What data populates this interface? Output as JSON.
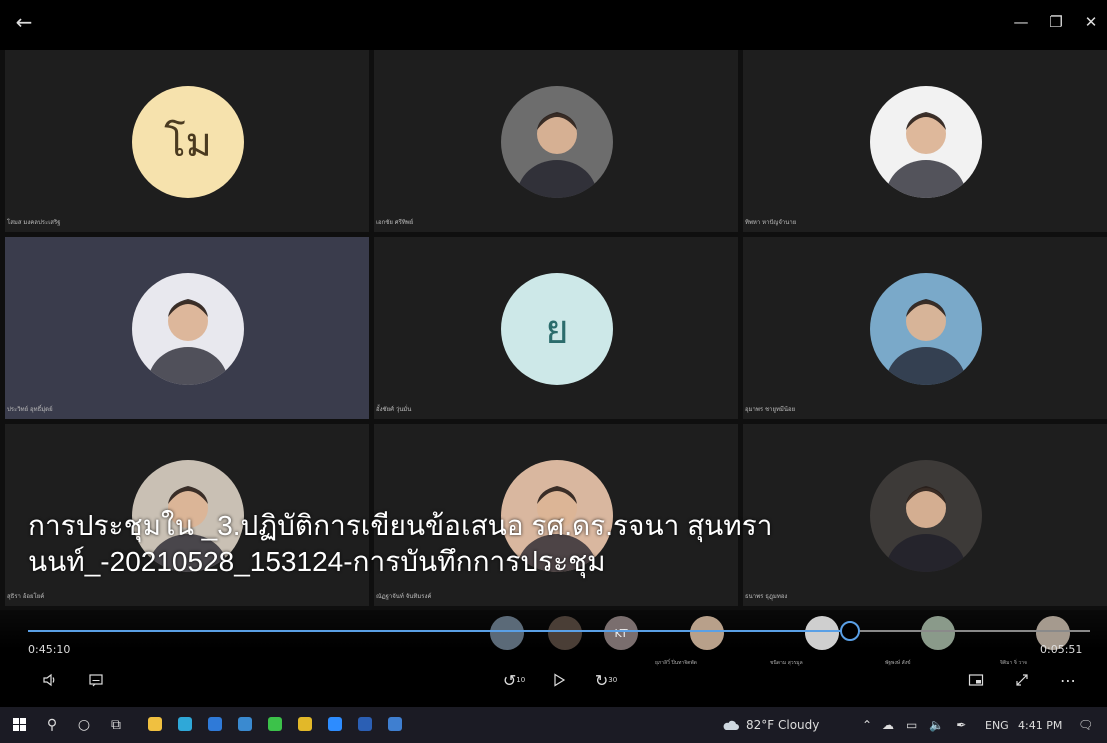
{
  "window": {
    "back_icon": "arrow-left-icon",
    "min_icon": "minimize-icon",
    "max_icon": "restore-icon",
    "close_icon": "close-icon"
  },
  "tiles": [
    {
      "name": "โสมส มงคลประเสริฐ",
      "initials": "โม",
      "avatar_color": "#f6e2ad",
      "active": false
    },
    {
      "name": "เอกชัย ศรีทิพย์",
      "initials": "",
      "avatar_color": "#6d6d6d",
      "active": false
    },
    {
      "name": "ทิพหา หาปัญจำนาย",
      "initials": "",
      "avatar_color": "#f2f2f2",
      "active": false
    },
    {
      "name": "ประวิทย์ อุทธิ์มุ่ดย์",
      "initials": "",
      "avatar_color": "#e8e8ee",
      "active": true
    },
    {
      "name": "อั้งชัยศ์ วุ่นมั่น",
      "initials": "ย",
      "avatar_color": "#cde8e8",
      "active": false
    },
    {
      "name": "อุมาพร ชายูทมีน้อย",
      "initials": "",
      "avatar_color": "#7aa9c9",
      "active": false
    },
    {
      "name": "สุธิรา อ้อยโยค์",
      "initials": "",
      "avatar_color": "#c9c0b4",
      "active": false
    },
    {
      "name": "ณัฏฐาจันท์ จันทิมรงค์",
      "initials": "",
      "avatar_color": "#d9b79f",
      "active": false
    },
    {
      "name": "ธนาพร ธุฎุมทอง",
      "initials": "",
      "avatar_color": "#3d3a38",
      "active": false
    }
  ],
  "caption": "การประชุมใน _3.ปฏิบัติการเขียนข้อเสนอ รศ.ดร.รจนา สุนทรานนท์_-20210528_153124-การบันทึกการประชุม",
  "strip": {
    "thumbs": [
      {
        "label": "",
        "color": "#5b6a78"
      },
      {
        "label": "",
        "color": "#4a3e36"
      },
      {
        "label": "KT",
        "color": "#7a6e6e"
      },
      {
        "label": "",
        "color": "#b8a08a"
      },
      {
        "label": "",
        "color": "#cfcfcf"
      },
      {
        "label": "",
        "color": "#8a9a8a"
      },
      {
        "label": "",
        "color": "#a59a8e"
      }
    ],
    "names": [
      "ยุภาลิวิ์ ปิ่นทาจิตพัด",
      "ชนิดาม สุวรมูล",
      "พัฐพงษ์ สังข์",
      "จิติมา จิ่ วาจ"
    ]
  },
  "player": {
    "current_time": "0:45:10",
    "remaining_time": "0:05:51",
    "progress": 0.774,
    "accent_color": "#5aa0e6",
    "volume_icon": "speaker-icon",
    "captions_icon": "captions-icon",
    "rewind_icon": "rewind-10-icon",
    "rewind_label": "10",
    "play_icon": "play-icon",
    "forward_icon": "forward-30-icon",
    "forward_label": "30",
    "pip_icon": "picture-in-picture-icon",
    "fullscreen_icon": "fullscreen-icon",
    "more_icon": "more-icon"
  },
  "taskbar": {
    "start_icon": "windows-icon",
    "search_icon": "search-icon",
    "cortana_icon": "cortana-icon",
    "taskview_icon": "task-view-icon",
    "apps": [
      {
        "icon": "file-explorer-icon",
        "color": "#f0c040"
      },
      {
        "icon": "edge-icon",
        "color": "#2fa8d8"
      },
      {
        "icon": "mail-icon",
        "color": "#2f7ad8"
      },
      {
        "icon": "internet-explorer-icon",
        "color": "#3a8ad0"
      },
      {
        "icon": "line-icon",
        "color": "#3cc24a"
      },
      {
        "icon": "chrome-icon",
        "color": "#e2b829"
      },
      {
        "icon": "zoom-icon",
        "color": "#2d8cff"
      },
      {
        "icon": "word-icon",
        "color": "#2b5fb4"
      },
      {
        "icon": "photos-icon",
        "color": "#3f7fd0"
      }
    ],
    "weather_icon": "cloud-icon",
    "weather": "82°F  Cloudy",
    "chevron_icon": "chevron-up-icon",
    "tray_icons": [
      "onedrive-icon",
      "battery-icon",
      "volume-icon",
      "pen-icon"
    ],
    "language": "ENG",
    "clock": "4:41 PM",
    "notification_icon": "notification-icon"
  }
}
